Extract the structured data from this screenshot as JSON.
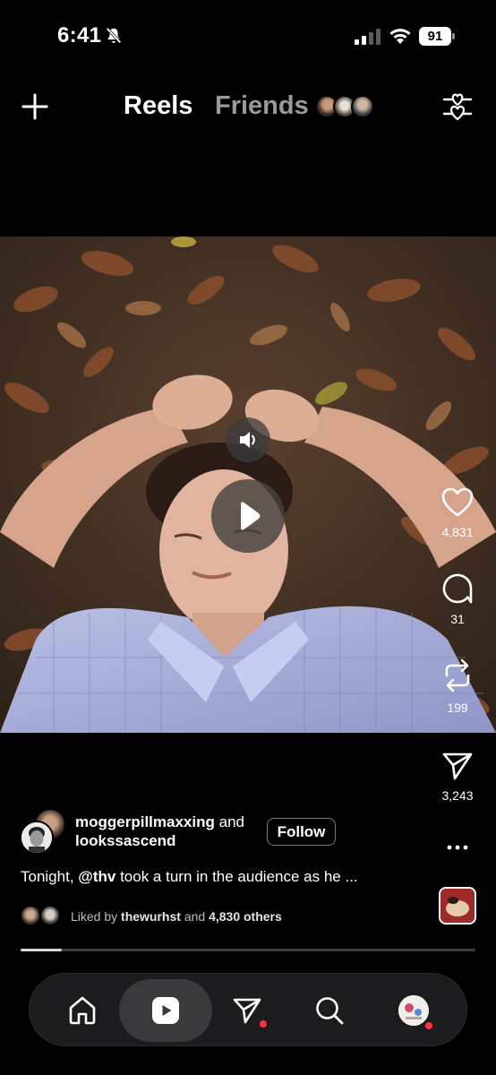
{
  "status_bar": {
    "time": "6:41",
    "battery": "91",
    "icons": [
      "bell-slash-icon",
      "cellular-signal-icon",
      "wifi-icon",
      "battery-icon"
    ]
  },
  "top_nav": {
    "tabs": [
      {
        "label": "Reels",
        "active": true
      },
      {
        "label": "Friends",
        "active": false
      }
    ],
    "icons": [
      "plus-icon",
      "friend-avatars",
      "filter-heart-icon"
    ]
  },
  "video": {
    "state": "paused",
    "controls": [
      "sound-icon",
      "play-icon"
    ]
  },
  "actions": {
    "likes": "4,831",
    "comments": "31",
    "reposts": "199",
    "shares": "3,243"
  },
  "post": {
    "author": "moggerpillmaxxing",
    "connector": "and",
    "coauthor": "lookssascend",
    "follow_label": "Follow",
    "caption_prefix": "Tonight, ",
    "caption_mention": "@thv",
    "caption_rest": " took a turn in the audience as he ...",
    "liked_prefix": "Liked by ",
    "liked_user": "thewurhst",
    "liked_middle": " and ",
    "liked_count": "4,830 others"
  },
  "playback": {
    "progress_fraction": 0.09
  },
  "bottom_nav": {
    "items": [
      "home-icon",
      "reels-icon",
      "send-icon",
      "search-icon",
      "profile-avatar"
    ],
    "active": "reels-icon",
    "colors": {
      "notification_dot": "#ff3040",
      "pill": "#1c1c1e"
    }
  }
}
